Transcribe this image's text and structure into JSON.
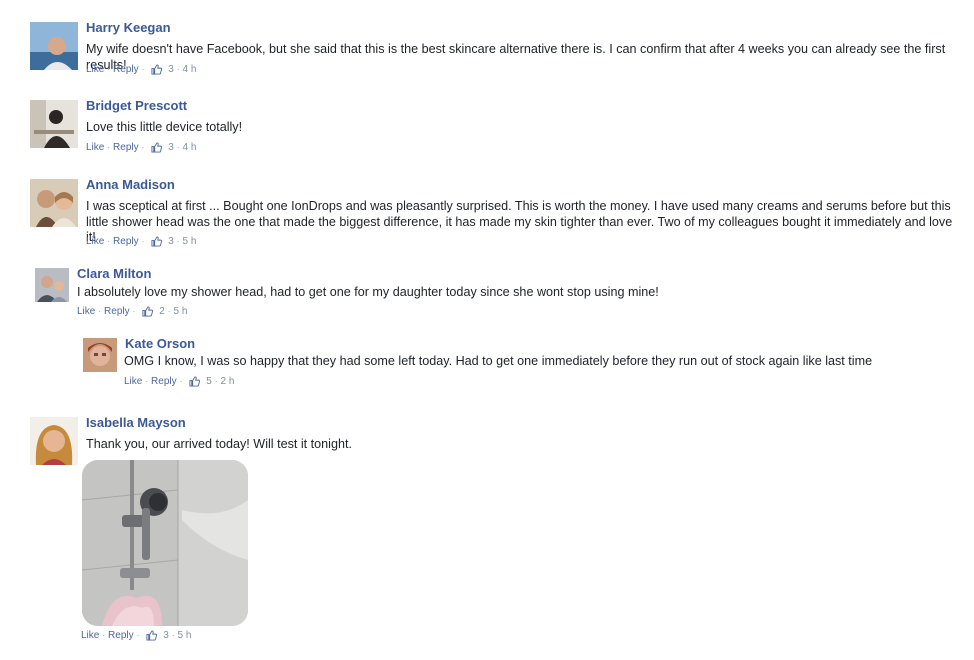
{
  "comments": [
    {
      "name": "Harry Keegan",
      "text": "My wife doesn't have Facebook, but she said that this is the best skincare alternative there is. I can confirm that after 4 weeks you can already see the first results!",
      "like_label": "Like",
      "reply_label": "Reply",
      "likes": "3",
      "time": "4 h",
      "avatar_icon": "avatar-photo"
    },
    {
      "name": "Bridget Prescott",
      "text": "Love this little device totally!",
      "like_label": "Like",
      "reply_label": "Reply",
      "likes": "3",
      "time": "4 h",
      "avatar_icon": "avatar-photo"
    },
    {
      "name": "Anna Madison",
      "text": "I was sceptical at first ... Bought one IonDrops and was pleasantly surprised. This is worth the money. I have used many creams and serums before but this little shower head was the one that made the biggest difference, it has made my skin tighter than ever. Two of my colleagues bought it immediately and love it!",
      "like_label": "Like",
      "reply_label": "Reply",
      "likes": "3",
      "time": "5 h",
      "avatar_icon": "avatar-photo"
    },
    {
      "name": "Clara Milton",
      "text": "I absolutely love my shower head, had to get one for my daughter today since she wont stop using mine!",
      "like_label": "Like",
      "reply_label": "Reply",
      "likes": "2",
      "time": "5 h",
      "avatar_icon": "avatar-photo"
    },
    {
      "name": "Kate Orson",
      "text": "OMG I know, I was so happy that they had some left today. Had to get one immediately before they run out of stock again like last time",
      "like_label": "Like",
      "reply_label": "Reply",
      "likes": "5",
      "time": "2 h",
      "avatar_icon": "avatar-photo",
      "is_reply": true
    },
    {
      "name": "Isabella Mayson",
      "text": "Thank you, our arrived today! Will test it tonight.",
      "like_label": "Like",
      "reply_label": "Reply",
      "likes": "3",
      "time": "5 h",
      "avatar_icon": "avatar-photo",
      "attachment_icon": "shower-head-photo"
    }
  ],
  "colors": {
    "name": "#3b5998",
    "link": "#4b67a1",
    "meta": "#7f8fa4",
    "text": "#1d2129"
  }
}
